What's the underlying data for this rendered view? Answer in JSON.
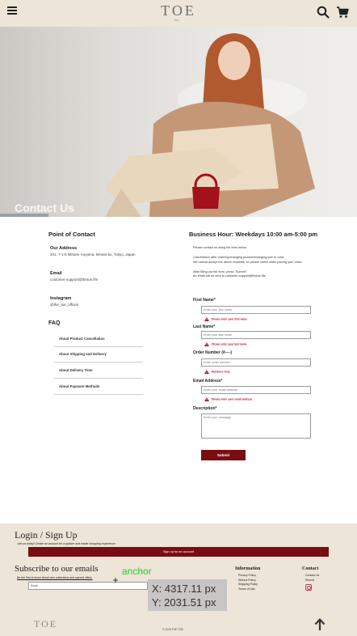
{
  "header": {
    "logo_text": "TOE",
    "logo_sub": "toe"
  },
  "hero": {
    "title": "Contact Us"
  },
  "contact": {
    "section_title": "Point of Contact",
    "address_label": "Our Address",
    "address_value": "101, 7-1-5 Minami-Aoyama, Minato-ku, Tokyo, Japan",
    "email_label": "Email",
    "email_value": "customer-support@thetoe.life",
    "instagram_label": "Instagram",
    "instagram_value": "@the_toe_official"
  },
  "faq": {
    "title": "FAQ",
    "items": [
      "About Product Cancellation",
      "About Shipping and Delivery",
      "About Delivery Time",
      "About Payment Methods"
    ]
  },
  "business": {
    "title": "Business Hour: Weekdays 10:00 am-5:00 pm",
    "note1": "Please contact us using the form below.",
    "note2": "Cancellation after ordering/changing product/changing size or color",
    "note3": "We cannot accept the above requests, so please check when placing your order.",
    "note4": "After filling out the form, press \"Submit\".",
    "note5": "An email will be sent to customer-support@thetoe.life"
  },
  "form": {
    "first_name_label": "First Name*",
    "first_name_placeholder": "Enter your first name",
    "first_name_error": "Please enter your first name",
    "last_name_label": "Last Name*",
    "last_name_placeholder": "Enter your last name",
    "last_name_error": "Please enter your last name",
    "order_label": "Order Number (#----)",
    "order_placeholder": "Enter order number",
    "order_error": "Numbers Only",
    "email_label": "Email Address*",
    "email_placeholder": "Enter your email address",
    "email_error": "Please enter your email address",
    "desc_label": "Description*",
    "desc_placeholder": "Enter your message",
    "submit_label": "Submit"
  },
  "footer": {
    "login_title": "Login / Sign Up",
    "login_sub": "Join us today! Create an account for a quicker and easier shopping experience.",
    "create_label": "Sign up for an account",
    "subscribe_title": "Subscribe to our emails",
    "subscribe_sub": "Be the first to know about new collections and special offers.",
    "email_placeholder": "Email",
    "information_title": "Information",
    "info_links": [
      "Privacy Policy",
      "Refund Policy",
      "Shipping Policy",
      "Terms of Use"
    ],
    "contact_title": "Contact",
    "contact_links": [
      "Contact Us",
      "Recruit"
    ],
    "logo_text": "TOE",
    "copyright": "© 2025 THE TOE"
  },
  "overlay": {
    "anchor_label": "anchor",
    "x_readout": "X: 4317.11 px",
    "y_readout": "Y: 2031.51 px"
  },
  "colors": {
    "header_bg": "#ece5d8",
    "accent": "#7a0d12",
    "error": "#b3121f",
    "anchor": "#2ec92e"
  }
}
